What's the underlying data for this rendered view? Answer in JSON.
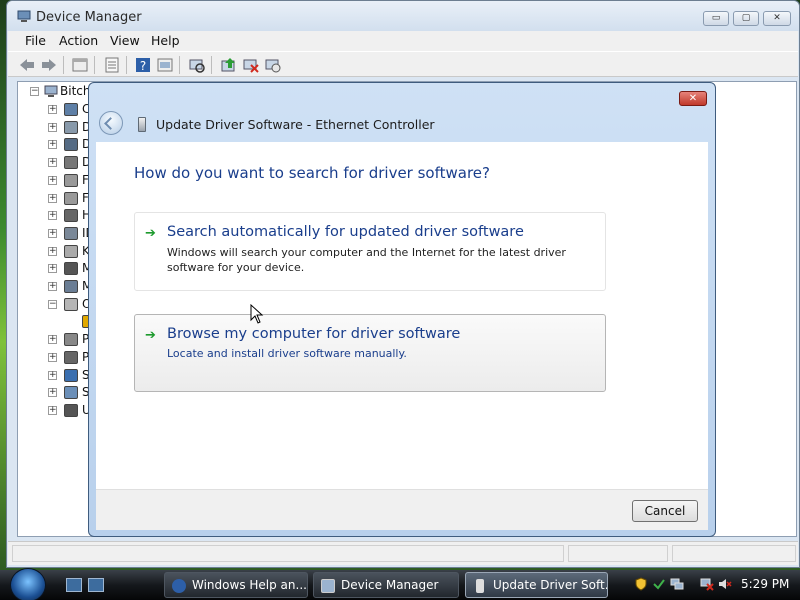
{
  "device_manager": {
    "title": "Device Manager",
    "window_buttons": {
      "minimize": "▭",
      "maximize": "▢",
      "close": "✕"
    },
    "menu": [
      "File",
      "Action",
      "View",
      "Help"
    ],
    "toolbar_icons": [
      "back-icon",
      "forward-icon",
      "up-icon",
      "properties-icon",
      "help-icon",
      "view-icon",
      "scan-hardware-icon",
      "update-driver-icon",
      "disable-icon",
      "uninstall-icon"
    ],
    "tree": {
      "root": "Bitch(",
      "items": [
        {
          "label": "Co",
          "expander": "+"
        },
        {
          "label": "Di",
          "expander": "+"
        },
        {
          "label": "Di",
          "expander": "+"
        },
        {
          "label": "DV",
          "expander": "+"
        },
        {
          "label": "Flo",
          "expander": "+"
        },
        {
          "label": "Flo",
          "expander": "+"
        },
        {
          "label": "Hu",
          "expander": "+"
        },
        {
          "label": "ID",
          "expander": "+"
        },
        {
          "label": "Ke",
          "expander": "+"
        },
        {
          "label": "Mi",
          "expander": "+"
        },
        {
          "label": "Mi",
          "expander": "+"
        },
        {
          "label": "Ot",
          "expander": "−"
        },
        {
          "label": "",
          "expander": ""
        },
        {
          "label": "Po",
          "expander": "+"
        },
        {
          "label": "Pr",
          "expander": "+"
        },
        {
          "label": "St",
          "expander": "+"
        },
        {
          "label": "Sy",
          "expander": "+"
        },
        {
          "label": "Ur",
          "expander": "+"
        }
      ]
    }
  },
  "dialog": {
    "title": "Update Driver Software - Ethernet Controller",
    "close_label": "✕",
    "question": "How do you want to search for driver software?",
    "options": [
      {
        "title": "Search automatically for updated driver software",
        "description": "Windows will search your computer and the Internet for the latest driver software for your device."
      },
      {
        "title": "Browse my computer for driver software",
        "description": "Locate and install driver software manually."
      }
    ],
    "arrow_glyph": "➔",
    "cancel_label": "Cancel"
  },
  "taskbar": {
    "tasks": [
      {
        "label": "Windows Help an...",
        "icon": "help-icon"
      },
      {
        "label": "Device Manager",
        "icon": "device-manager-icon"
      },
      {
        "label": "Update Driver Soft...",
        "icon": "driver-icon",
        "active": true
      }
    ],
    "clock": "5:29 PM"
  },
  "colors": {
    "accent_text": "#1a3e8c",
    "arrow_green": "#1d9a2d",
    "dialog_frame": "#b8d0ec"
  }
}
